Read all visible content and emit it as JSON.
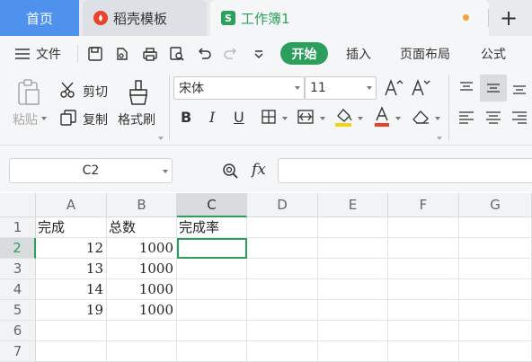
{
  "tabs": {
    "home": "首页",
    "template": "稻壳模板",
    "workbook": "工作簿1",
    "new_tab": "+"
  },
  "menu": {
    "file": "文件",
    "items": [
      "开始",
      "插入",
      "页面布局",
      "公式"
    ]
  },
  "ribbon": {
    "paste": "粘贴",
    "cut": "剪切",
    "copy": "复制",
    "format_painter": "格式刷",
    "font_name": "宋体",
    "font_size": "11",
    "bold": "B",
    "italic": "I",
    "underline": "U"
  },
  "formula_bar": {
    "name_box": "C2",
    "fx": "fx",
    "value": ""
  },
  "sheet": {
    "columns": [
      "A",
      "B",
      "C",
      "D",
      "E",
      "F",
      "G"
    ],
    "rows": [
      "1",
      "2",
      "3",
      "4",
      "5",
      "6",
      "7"
    ],
    "cells": {
      "A1": "完成",
      "B1": "总数",
      "C1": "完成率",
      "A2": "12",
      "B2": "1000",
      "A3": "13",
      "B3": "1000",
      "A4": "14",
      "B4": "1000",
      "A5": "19",
      "B5": "1000"
    },
    "active_cell": "C2"
  },
  "colors": {
    "accent": "#2b9f5b",
    "home_tab": "#4e92ee",
    "template_icon": "#e8412c"
  }
}
